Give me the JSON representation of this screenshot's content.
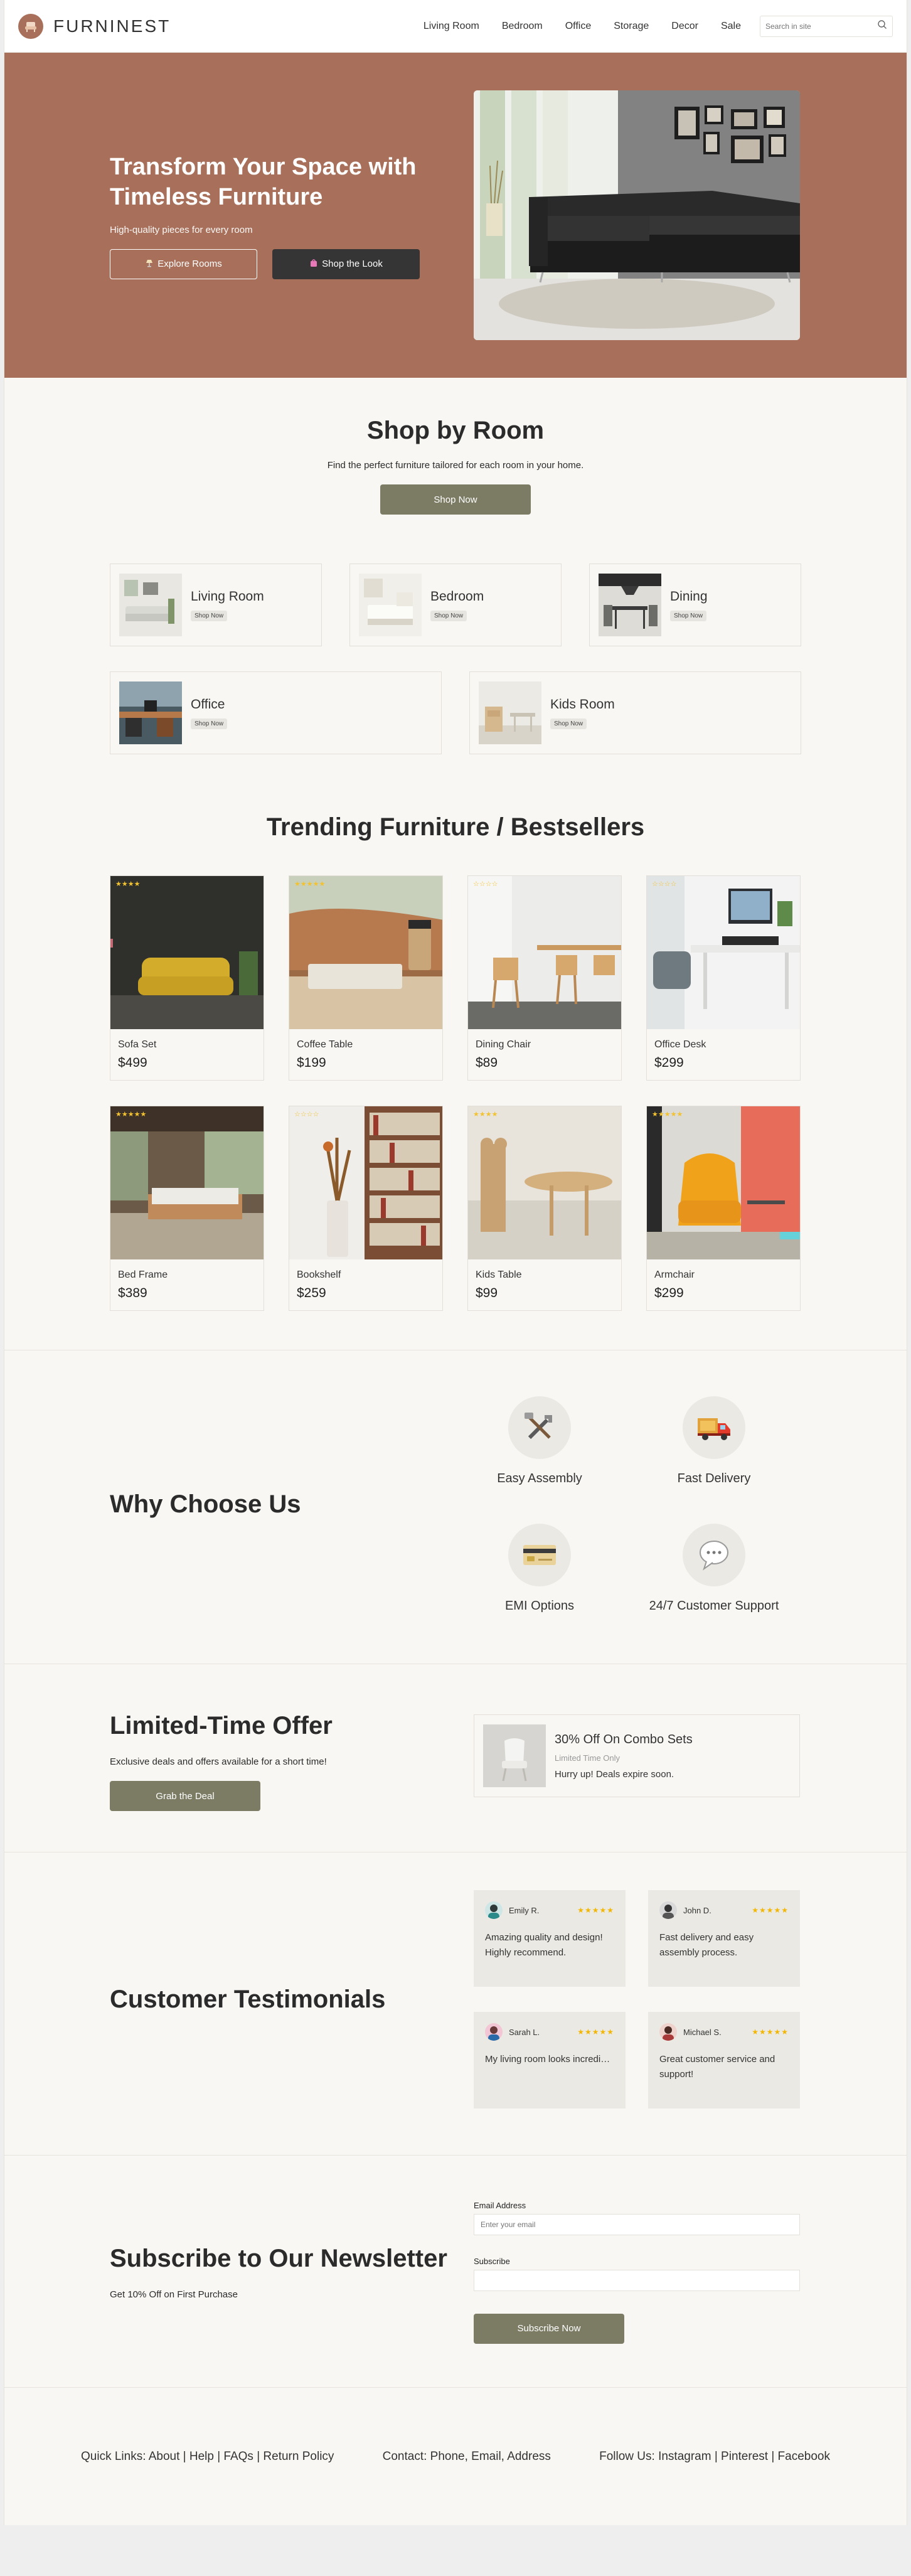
{
  "header": {
    "brand": "FURNINEST",
    "nav": [
      "Living Room",
      "Bedroom",
      "Office",
      "Storage",
      "Decor",
      "Sale"
    ],
    "search_placeholder": "Search in site"
  },
  "hero": {
    "title": "Transform Your Space with Timeless Furniture",
    "subtitle": "High-quality pieces for every room",
    "explore_label": "Explore Rooms",
    "shop_look_label": "Shop the Look"
  },
  "shop_by_room": {
    "title": "Shop by Room",
    "lead": "Find the perfect furniture tailored for each room in your home.",
    "button": "Shop Now",
    "rooms": [
      {
        "name": "Living Room",
        "tag": "Shop Now"
      },
      {
        "name": "Bedroom",
        "tag": "Shop Now"
      },
      {
        "name": "Dining",
        "tag": "Shop Now"
      },
      {
        "name": "Office",
        "tag": "Shop Now"
      },
      {
        "name": "Kids Room",
        "tag": "Shop Now"
      }
    ]
  },
  "trending": {
    "title": "Trending Furniture / Bestsellers",
    "products": [
      {
        "name": "Sofa Set",
        "price": "$499",
        "stars": "★★★★"
      },
      {
        "name": "Coffee Table",
        "price": "$199",
        "stars": "★★★★★"
      },
      {
        "name": "Dining Chair",
        "price": "$89",
        "stars": "☆☆☆☆"
      },
      {
        "name": "Office Desk",
        "price": "$299",
        "stars": "☆☆☆☆"
      },
      {
        "name": "Bed Frame",
        "price": "$389",
        "stars": "★★★★★"
      },
      {
        "name": "Bookshelf",
        "price": "$259",
        "stars": "☆☆☆☆"
      },
      {
        "name": "Kids Table",
        "price": "$99",
        "stars": "★★★★"
      },
      {
        "name": "Armchair",
        "price": "$299",
        "stars": "★★★★★"
      }
    ]
  },
  "why": {
    "title": "Why Choose Us",
    "features": [
      {
        "label": "Easy Assembly",
        "icon": "tools-icon"
      },
      {
        "label": "Fast Delivery",
        "icon": "truck-icon"
      },
      {
        "label": "EMI Options",
        "icon": "credit-card-icon"
      },
      {
        "label": "24/7 Customer Support",
        "icon": "speech-bubble-icon"
      }
    ]
  },
  "offer": {
    "title": "Limited-Time Offer",
    "subtitle": "Exclusive deals and offers available for a short time!",
    "button": "Grab the Deal",
    "card_title": "30% Off On Combo Sets",
    "card_note": "Limited Time Only",
    "card_desc": "Hurry up! Deals expire soon."
  },
  "testimonials": {
    "title": "Customer Testimonials",
    "items": [
      {
        "name": "Emily R.",
        "stars": "★★★★★",
        "text": "Amazing quality and design! Highly recommend."
      },
      {
        "name": "John D.",
        "stars": "★★★★★",
        "text": "Fast delivery and easy assembly process."
      },
      {
        "name": "Sarah L.",
        "stars": "★★★★★",
        "text": "My living room looks incredible!"
      },
      {
        "name": "Michael S.",
        "stars": "★★★★★",
        "text": "Great customer service and support!"
      }
    ]
  },
  "newsletter": {
    "title": "Subscribe to Our Newsletter",
    "subtitle": "Get 10% Off on First Purchase",
    "email_label": "Email Address",
    "email_placeholder": "Enter your email",
    "second_label": "Subscribe",
    "button": "Subscribe Now"
  },
  "footer": {
    "quick_links": "Quick Links: About | Help | FAQs | Return Policy",
    "contact": "Contact: Phone, Email, Address",
    "follow": "Follow Us: Instagram | Pinterest | Facebook"
  },
  "colors": {
    "hero_bg": "#a8705a",
    "olive_button": "#7c7b64",
    "dark_button": "#353535",
    "star": "#f2c230"
  }
}
